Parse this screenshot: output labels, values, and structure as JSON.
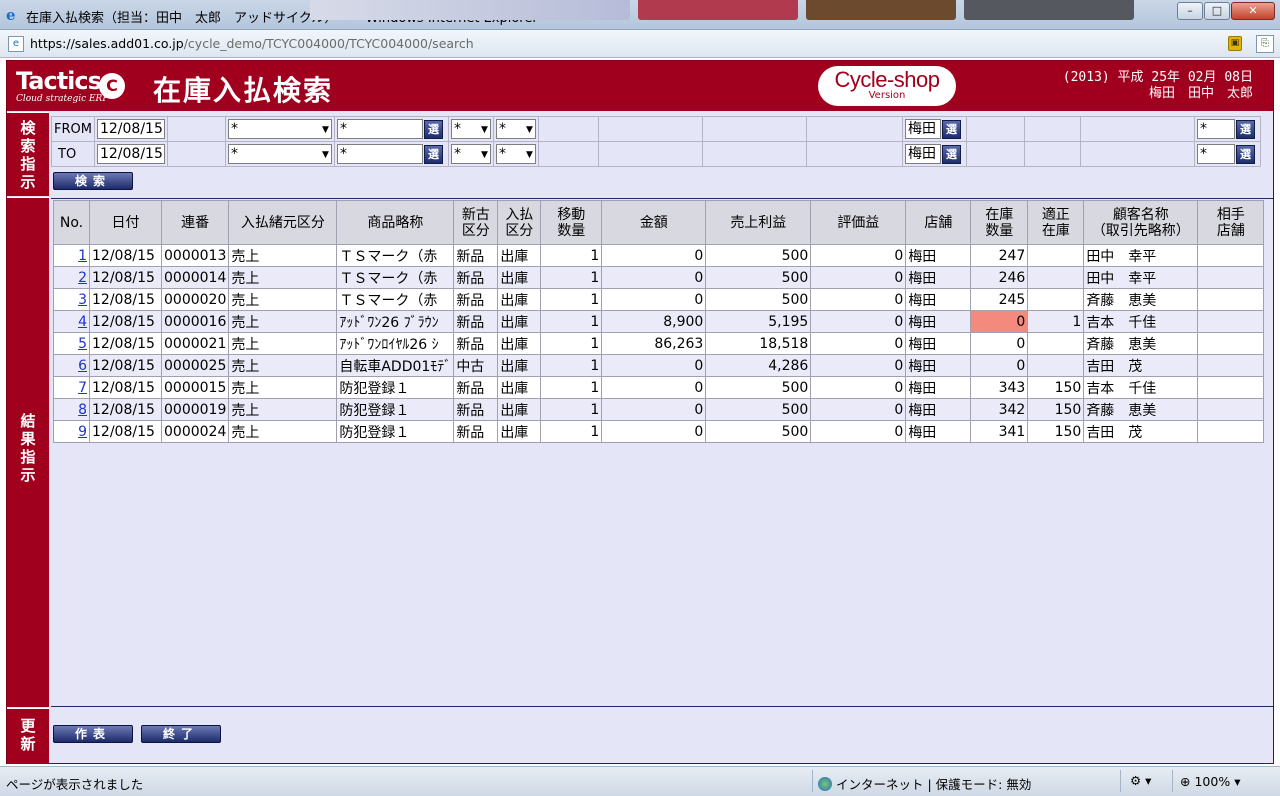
{
  "window": {
    "title": "在庫入払検索（担当：田中　太郎　アッドサイクル）　　- Windows Internet Explorer",
    "url_host": "https://sales.add01.co.jp",
    "url_path": "/cycle_demo/TCYC004000/TCYC004000/search",
    "controls": {
      "minimize": "–",
      "maximize": "□",
      "close": "✕"
    }
  },
  "header": {
    "logo_main": "Tactics",
    "logo_mark": "C",
    "logo_sub": "Cloud strategic ERP",
    "title": "在庫入払検索",
    "brand": "Cycle-shop",
    "brand_sub": "Version",
    "date_line": "(2013) 平成 25年 02月 08日",
    "user_line": "梅田　田中　太郎"
  },
  "labels": {
    "search": [
      "検",
      "索",
      "指",
      "示"
    ],
    "results": [
      "結",
      "果",
      "指",
      "示"
    ],
    "update": [
      "更",
      "新"
    ]
  },
  "search": {
    "from_label": "FROM",
    "to_label": "TO",
    "from_date": "12/08/15",
    "to_date": "12/08/15",
    "from_kbn": "*",
    "to_kbn": "*",
    "from_item": "*",
    "to_item": "*",
    "from_new": "*",
    "to_new": "*",
    "from_inout": "*",
    "to_inout": "*",
    "from_store": "梅田",
    "to_store": "梅田",
    "from_partner": "*",
    "to_partner": "*",
    "pick_label": "選",
    "search_button": "検索"
  },
  "results": {
    "columns": [
      "No.",
      "日付",
      "連番",
      "入払緒元区分",
      "商品略称",
      "新古\n区分",
      "入払\n区分",
      "移動\n数量",
      "金額",
      "売上利益",
      "評価益",
      "店舗",
      "在庫\n数量",
      "適正\n在庫",
      "顧客名称\n（取引先略称）",
      "相手\n店舗"
    ],
    "rows": [
      {
        "no": "1",
        "date": "12/08/15",
        "seq": "0000013",
        "kbn": "売上",
        "item": "ＴＳマーク（赤",
        "newold": "新品",
        "inout": "出庫",
        "qty": "1",
        "amount": "0",
        "profit": "500",
        "gain": "0",
        "store": "梅田",
        "stock": "247",
        "proper": "",
        "customer": "田中　幸平",
        "partner": ""
      },
      {
        "no": "2",
        "date": "12/08/15",
        "seq": "0000014",
        "kbn": "売上",
        "item": "ＴＳマーク（赤",
        "newold": "新品",
        "inout": "出庫",
        "qty": "1",
        "amount": "0",
        "profit": "500",
        "gain": "0",
        "store": "梅田",
        "stock": "246",
        "proper": "",
        "customer": "田中　幸平",
        "partner": ""
      },
      {
        "no": "3",
        "date": "12/08/15",
        "seq": "0000020",
        "kbn": "売上",
        "item": "ＴＳマーク（赤",
        "newold": "新品",
        "inout": "出庫",
        "qty": "1",
        "amount": "0",
        "profit": "500",
        "gain": "0",
        "store": "梅田",
        "stock": "245",
        "proper": "",
        "customer": "斉藤　恵美",
        "partner": ""
      },
      {
        "no": "4",
        "date": "12/08/15",
        "seq": "0000016",
        "kbn": "売上",
        "item": "ｱｯﾄﾞﾜﾝ26 ﾌﾞﾗｳﾝ",
        "newold": "新品",
        "inout": "出庫",
        "qty": "1",
        "amount": "8,900",
        "profit": "5,195",
        "gain": "0",
        "store": "梅田",
        "stock": "0",
        "proper": "1",
        "customer": "吉本　千佳",
        "partner": "",
        "highlight": true
      },
      {
        "no": "5",
        "date": "12/08/15",
        "seq": "0000021",
        "kbn": "売上",
        "item": "ｱｯﾄﾞﾜﾝﾛｲﾔﾙ26 ｼ",
        "newold": "新品",
        "inout": "出庫",
        "qty": "1",
        "amount": "86,263",
        "profit": "18,518",
        "gain": "0",
        "store": "梅田",
        "stock": "0",
        "proper": "",
        "customer": "斉藤　恵美",
        "partner": ""
      },
      {
        "no": "6",
        "date": "12/08/15",
        "seq": "0000025",
        "kbn": "売上",
        "item": "自転車ADD01ﾓﾃﾞ",
        "newold": "中古",
        "inout": "出庫",
        "qty": "1",
        "amount": "0",
        "profit": "4,286",
        "gain": "0",
        "store": "梅田",
        "stock": "0",
        "proper": "",
        "customer": "吉田　茂",
        "partner": ""
      },
      {
        "no": "7",
        "date": "12/08/15",
        "seq": "0000015",
        "kbn": "売上",
        "item": "防犯登録１",
        "newold": "新品",
        "inout": "出庫",
        "qty": "1",
        "amount": "0",
        "profit": "500",
        "gain": "0",
        "store": "梅田",
        "stock": "343",
        "proper": "150",
        "customer": "吉本　千佳",
        "partner": ""
      },
      {
        "no": "8",
        "date": "12/08/15",
        "seq": "0000019",
        "kbn": "売上",
        "item": "防犯登録１",
        "newold": "新品",
        "inout": "出庫",
        "qty": "1",
        "amount": "0",
        "profit": "500",
        "gain": "0",
        "store": "梅田",
        "stock": "342",
        "proper": "150",
        "customer": "斉藤　恵美",
        "partner": ""
      },
      {
        "no": "9",
        "date": "12/08/15",
        "seq": "0000024",
        "kbn": "売上",
        "item": "防犯登録１",
        "newold": "新品",
        "inout": "出庫",
        "qty": "1",
        "amount": "0",
        "profit": "500",
        "gain": "0",
        "store": "梅田",
        "stock": "341",
        "proper": "150",
        "customer": "吉田　茂",
        "partner": ""
      }
    ]
  },
  "update": {
    "make_button": "作表",
    "exit_button": "終了"
  },
  "status": {
    "message": "ページが表示されました",
    "zone": "インターネット | 保護モード: 無効",
    "zoom": "100%"
  },
  "colors": {
    "brand": "#a0001e",
    "page_bg": "#e5e5f8",
    "button": "#1e2b6b",
    "highlight": "#f48a7e"
  }
}
